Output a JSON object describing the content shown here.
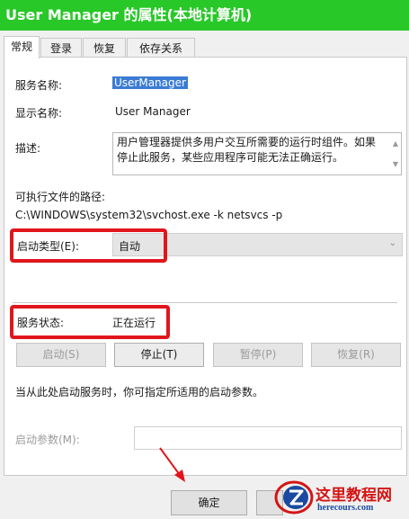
{
  "window": {
    "title": "User Manager 的属性(本地计算机)"
  },
  "tabs": [
    {
      "label": "常规",
      "active": true
    },
    {
      "label": "登录",
      "active": false
    },
    {
      "label": "恢复",
      "active": false
    },
    {
      "label": "依存关系",
      "active": false
    }
  ],
  "general": {
    "service_name_label": "服务名称:",
    "service_name_value": "UserManager",
    "display_name_label": "显示名称:",
    "display_name_value": "User Manager",
    "description_label": "描述:",
    "description_value": "用户管理器提供多用户交互所需要的运行时组件。如果停止此服务，某些应用程序可能无法正确运行。",
    "path_label": "可执行文件的路径:",
    "path_value": "C:\\WINDOWS\\system32\\svchost.exe -k netsvcs -p",
    "startup_type_label": "启动类型(E):",
    "startup_type_value": "自动",
    "status_label": "服务状态:",
    "status_value": "正在运行"
  },
  "service_buttons": {
    "start": "启动(S)",
    "stop": "停止(T)",
    "pause": "暂停(P)",
    "resume": "恢复(R)"
  },
  "hint_text": "当从此处启动服务时，你可指定所适用的启动参数。",
  "start_params_label": "启动参数(M):",
  "start_params_value": "",
  "dialog_buttons": {
    "ok": "确定"
  },
  "watermark": {
    "title": "这里教程网",
    "url": "herecours.com"
  },
  "colors": {
    "titlebar": "#28c828",
    "highlight": "#e0161c",
    "selection": "#3a7bd5"
  }
}
